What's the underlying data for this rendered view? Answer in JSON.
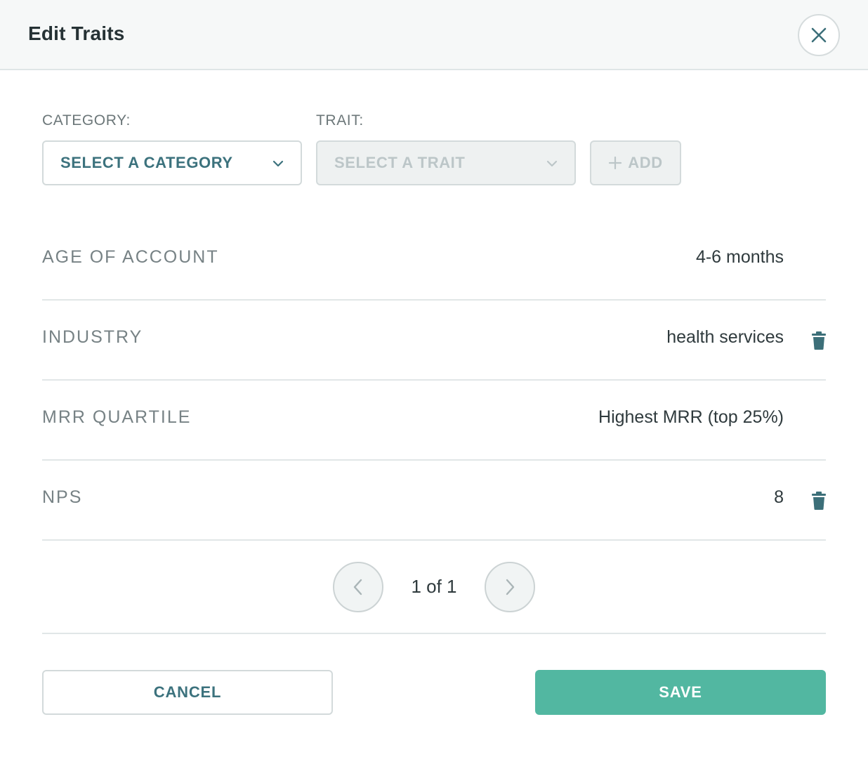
{
  "dialog": {
    "title": "Edit Traits"
  },
  "form": {
    "category_label": "CATEGORY:",
    "trait_label": "TRAIT:",
    "category_select": "SELECT A CATEGORY",
    "trait_select": "SELECT A TRAIT",
    "add_label": "ADD"
  },
  "traits": [
    {
      "name": "AGE OF ACCOUNT",
      "value": "4-6 months",
      "deletable": false
    },
    {
      "name": "INDUSTRY",
      "value": "health services",
      "deletable": true
    },
    {
      "name": "MRR QUARTILE",
      "value": "Highest MRR (top 25%)",
      "deletable": false
    },
    {
      "name": "NPS",
      "value": "8",
      "deletable": true
    }
  ],
  "pagination": {
    "text": "1 of 1"
  },
  "footer": {
    "cancel_label": "CANCEL",
    "save_label": "SAVE"
  },
  "colors": {
    "accent": "#52b7a1",
    "link": "#3c727d",
    "trash": "#3c6f79"
  },
  "icons": {
    "close": "close-icon",
    "dropdown": "chevron-down-icon",
    "add": "plus-icon",
    "delete": "trash-icon",
    "prev": "chevron-left-icon",
    "next": "chevron-right-icon"
  }
}
